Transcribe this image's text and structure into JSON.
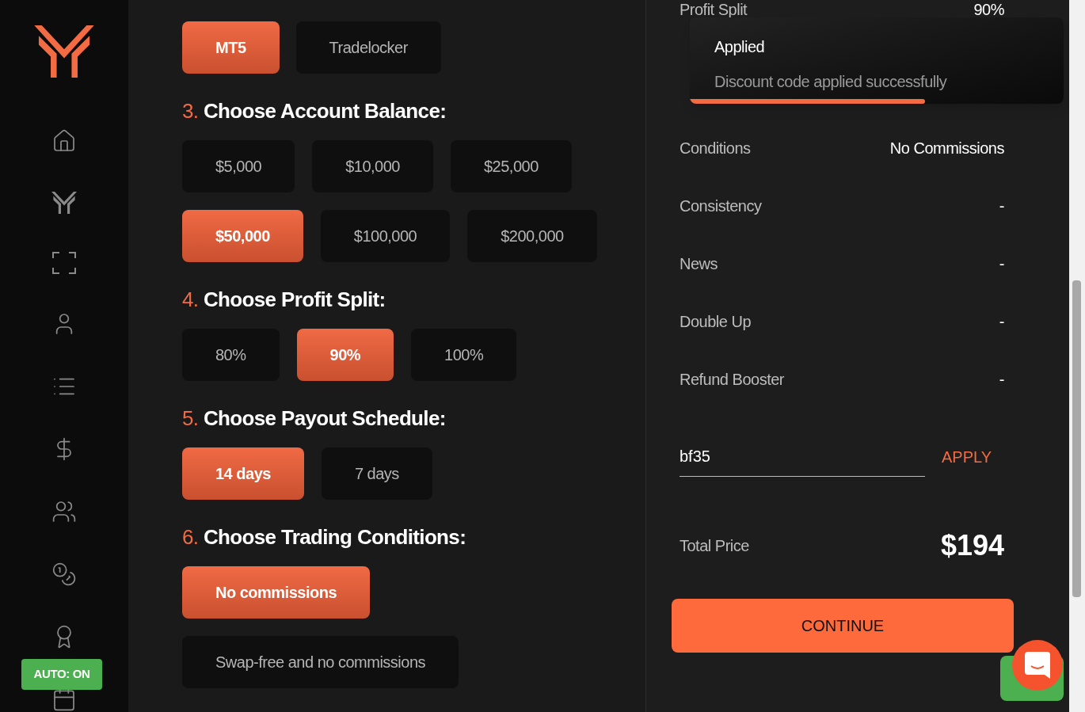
{
  "platforms": [
    {
      "label": "MT5",
      "selected": true
    },
    {
      "label": "Tradelocker",
      "selected": false
    }
  ],
  "sections": [
    {
      "number": "3.",
      "title": "Choose Account Balance:",
      "options": [
        {
          "label": "$5,000",
          "selected": false
        },
        {
          "label": "$10,000",
          "selected": false
        },
        {
          "label": "$25,000",
          "selected": false
        },
        {
          "label": "$50,000",
          "selected": true
        },
        {
          "label": "$100,000",
          "selected": false
        },
        {
          "label": "$200,000",
          "selected": false
        }
      ]
    },
    {
      "number": "4.",
      "title": "Choose Profit Split:",
      "options": [
        {
          "label": "80%",
          "selected": false
        },
        {
          "label": "90%",
          "selected": true
        },
        {
          "label": "100%",
          "selected": false
        }
      ]
    },
    {
      "number": "5.",
      "title": "Choose Payout Schedule:",
      "options": [
        {
          "label": "14 days",
          "selected": true
        },
        {
          "label": "7 days",
          "selected": false
        }
      ]
    },
    {
      "number": "6.",
      "title": "Choose Trading Conditions:",
      "options": [
        {
          "label": "No commissions",
          "selected": true
        },
        {
          "label": "Swap-free and no commissions",
          "selected": false
        }
      ]
    }
  ],
  "summary": [
    {
      "label": "Profit Split",
      "value": "90%"
    },
    {
      "label": "Conditions",
      "value": "No Commissions"
    },
    {
      "label": "Consistency",
      "value": "-"
    },
    {
      "label": "News",
      "value": "-"
    },
    {
      "label": "Double Up",
      "value": "-"
    },
    {
      "label": "Refund Booster",
      "value": "-"
    }
  ],
  "discount": {
    "value": "bf35",
    "button": "APPLY"
  },
  "total": {
    "label": "Total Price",
    "value": "$194"
  },
  "continue_button": "CONTINUE",
  "toast": {
    "title": "Applied",
    "message": "Discount code applied successfully",
    "level": 0.63
  },
  "auto_badge": "AUTO: ON"
}
